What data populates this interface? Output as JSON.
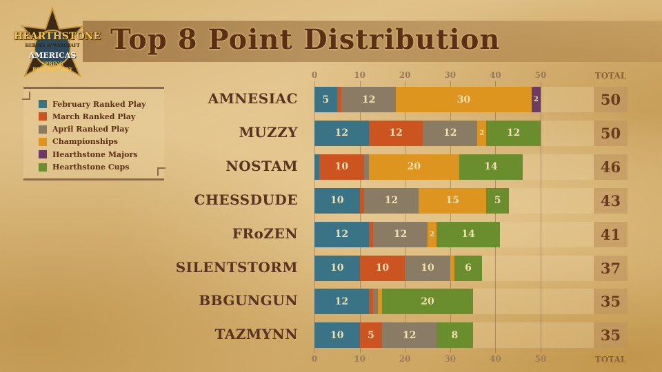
{
  "title": "Top 8 Point Distribution",
  "logo": {
    "brand": "HEARTHSTONE",
    "subtitle": "HEROES of WARCRAFT",
    "region": "AMERICAS",
    "season": "SPRING",
    "event": "PRELIMINARY"
  },
  "chart_data": {
    "type": "bar",
    "orientation": "horizontal",
    "stacked": true,
    "title": "Top 8 Point Distribution",
    "xlabel": "",
    "ylabel": "",
    "xlim": [
      0,
      50
    ],
    "xticks": [
      "0",
      "10",
      "20",
      "30",
      "40",
      "50"
    ],
    "grid": true,
    "legend_position": "left",
    "total_header": "TOTAL",
    "categories": [
      "AMNESIAC",
      "MUZZY",
      "NOSTAM",
      "CHESSDUDE",
      "FRoZEN",
      "SILENTSTORM",
      "BBGUNGUN",
      "TAZMYNN"
    ],
    "series": [
      {
        "name": "February Ranked Play",
        "color": "#3a7286",
        "values": [
          5,
          12,
          1,
          10,
          12,
          10,
          12,
          10
        ]
      },
      {
        "name": "March Ranked Play",
        "color": "#cc5420",
        "values": [
          1,
          12,
          10,
          1,
          1,
          10,
          1,
          5
        ]
      },
      {
        "name": "April Ranked Play",
        "color": "#8a7c64",
        "values": [
          12,
          12,
          1,
          12,
          12,
          10,
          1,
          12
        ]
      },
      {
        "name": "Championships",
        "color": "#dd9520",
        "values": [
          30,
          2,
          20,
          15,
          2,
          1,
          1,
          0
        ]
      },
      {
        "name": "Hearthstone Majors",
        "color": "#6c3a66",
        "values": [
          2,
          0,
          0,
          0,
          0,
          0,
          0,
          0
        ]
      },
      {
        "name": "Hearthstone Cups",
        "color": "#6a8d2e",
        "values": [
          0,
          12,
          14,
          5,
          14,
          6,
          20,
          8
        ]
      }
    ],
    "segment_labels": [
      [
        "5",
        "",
        "12",
        "30",
        "2",
        ""
      ],
      [
        "12",
        "12",
        "12",
        "2",
        "",
        "12"
      ],
      [
        "",
        "10",
        "",
        "20",
        "",
        "14"
      ],
      [
        "10",
        "",
        "12",
        "15",
        "",
        "5"
      ],
      [
        "12",
        "",
        "12",
        "2",
        "",
        "14"
      ],
      [
        "10",
        "10",
        "10",
        "",
        "",
        "6"
      ],
      [
        "12",
        "",
        "",
        "",
        "",
        "20"
      ],
      [
        "10",
        "5",
        "12",
        "",
        "",
        "8"
      ]
    ],
    "totals": [
      50,
      50,
      46,
      43,
      41,
      37,
      35,
      35
    ]
  }
}
